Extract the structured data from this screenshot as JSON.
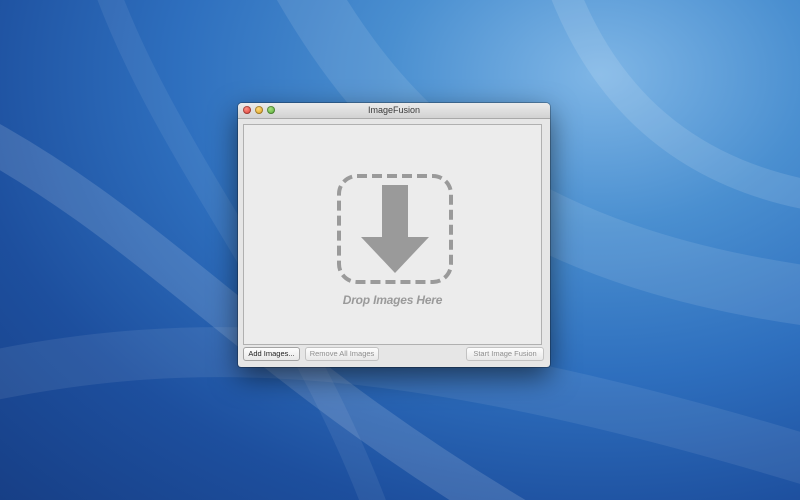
{
  "window": {
    "title": "ImageFusion"
  },
  "drop_zone": {
    "label": "Drop Images Here",
    "icon": "download-arrow-icon"
  },
  "buttons": {
    "add_images": "Add Images...",
    "remove_all_images": "Remove All Images",
    "start_image_fusion": "Start Image Fusion"
  },
  "colors": {
    "desktop_blue": "#2e6fbe",
    "window_background": "#e6e6e6",
    "drop_graphic_gray": "#9a9a9a"
  }
}
